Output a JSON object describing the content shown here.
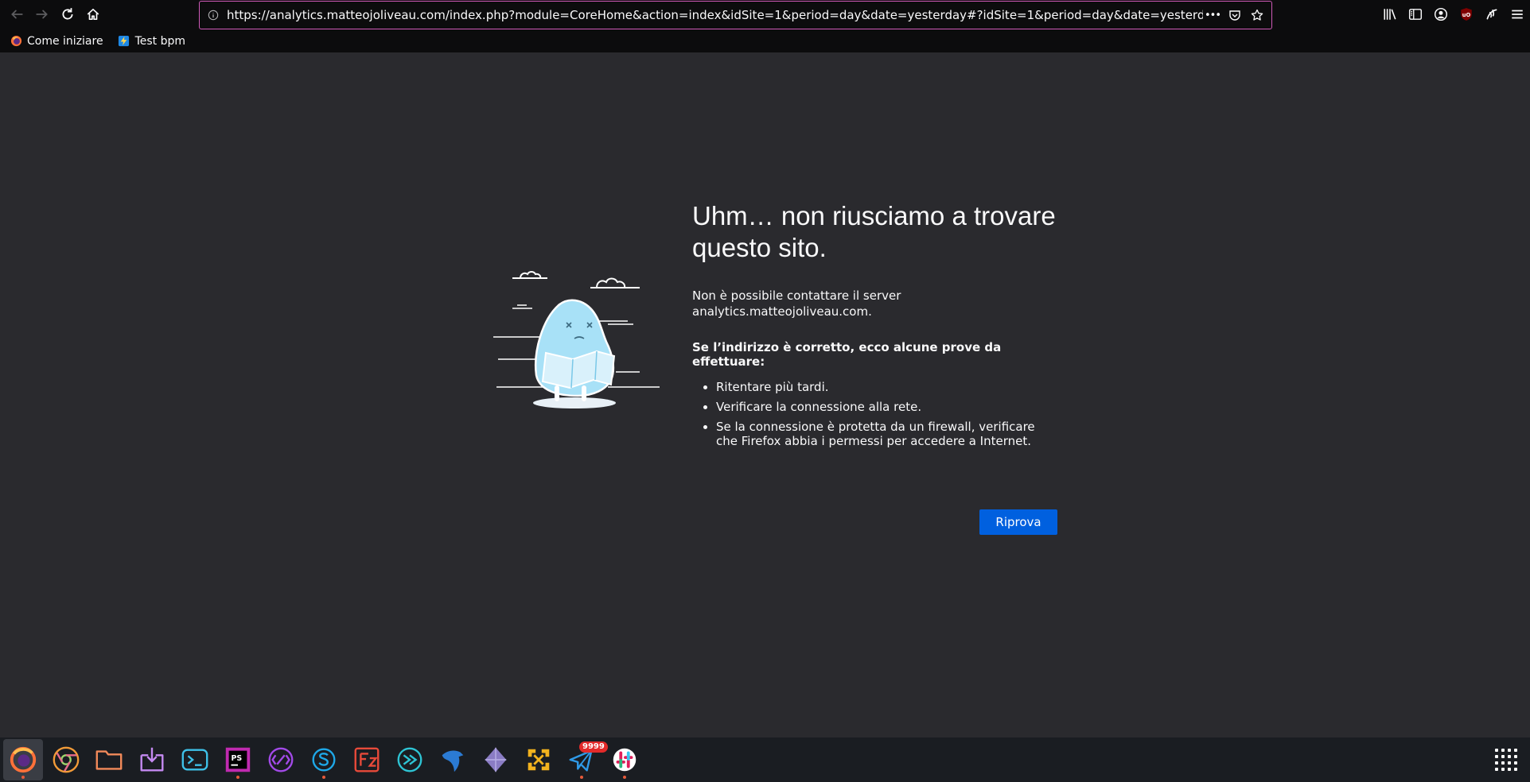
{
  "browser": {
    "url": "https://analytics.matteojoliveau.com/index.php?module=CoreHome&action=index&idSite=1&period=day&date=yesterday#?idSite=1&period=day&date=yesterday&category=Da",
    "overflow_label": "•••"
  },
  "bookmarks": [
    {
      "label": "Come iniziare",
      "icon": "firefox-icon"
    },
    {
      "label": "Test bpm",
      "icon": "bolt-icon"
    }
  ],
  "error": {
    "title": "Uhm… non riusciamo a trovare questo sito.",
    "short_desc": "Non è possibile contattare il server analytics.matteojoliveau.com.",
    "hint": "Se l’indirizzo è corretto, ecco alcune prove da effettuare:",
    "suggestions": [
      "Ritentare più tardi.",
      "Verificare la connessione alla rete.",
      "Se la connessione è protetta da un firewall, verificare che Firefox abbia i permessi per accedere a Internet."
    ],
    "retry_label": "Riprova"
  },
  "taskbar": {
    "apps": [
      "firefox-icon",
      "chrome-icon",
      "files-icon",
      "installer-icon",
      "terminal-icon",
      "phpstorm-icon",
      "vscode-icon",
      "skype-icon",
      "filezilla-icon",
      "remote-desktop-icon",
      "dbeaver-icon",
      "crystal-icon",
      "vpn-icon",
      "mail-icon",
      "slack-icon"
    ],
    "mail_badge": "9999"
  },
  "colors": {
    "accent": "#0060df",
    "background": "#2a2a2e",
    "toolbar": "#0c0c0d",
    "urlbar_border": "#d05ab8"
  }
}
